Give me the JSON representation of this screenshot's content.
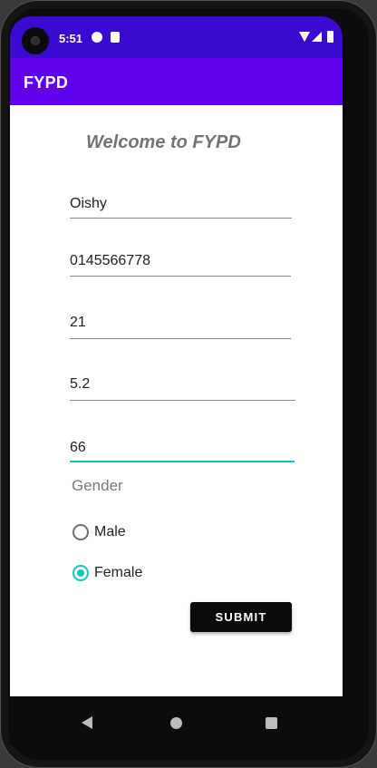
{
  "status_bar": {
    "time": "5:51",
    "icons": [
      "camera-icon",
      "notification-icon",
      "sd-card-icon",
      "wifi-icon",
      "signal-icon",
      "battery-icon"
    ]
  },
  "app_bar": {
    "title": "FYPD"
  },
  "main": {
    "welcome": "Welcome to FYPD",
    "fields": [
      {
        "value": "Oishy"
      },
      {
        "value": "0145566778"
      },
      {
        "value": "21"
      },
      {
        "value": "5.2"
      },
      {
        "value": "66"
      }
    ],
    "gender_label": "Gender",
    "radio_options": [
      {
        "label": "Male",
        "checked": false
      },
      {
        "label": "Female",
        "checked": true
      }
    ],
    "submit_label": "SUBMIT"
  },
  "colors": {
    "status_bar": "#3a0ad1",
    "app_bar": "#6002ee",
    "accent": "#12c6c0",
    "button": "#0b0b0b"
  },
  "nav_bar": {
    "icons": [
      "back-icon",
      "home-icon",
      "recents-icon"
    ]
  }
}
